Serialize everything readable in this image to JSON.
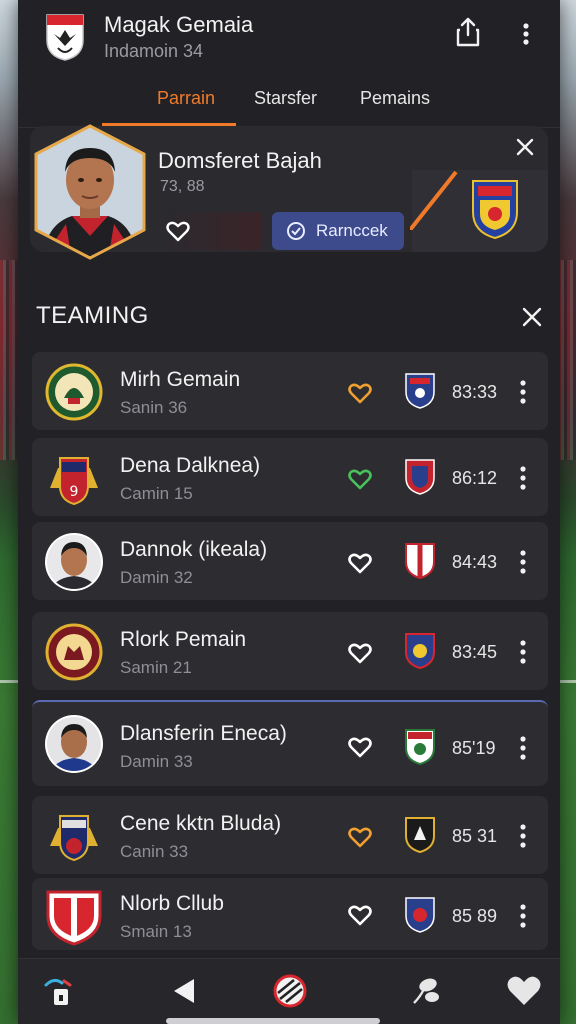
{
  "header": {
    "title": "Magak Gemaia",
    "subtitle": "Indamoin 34",
    "logo_icon": "club-crest-icon",
    "share_icon": "share-icon",
    "more_icon": "more-vertical-icon"
  },
  "tabs": [
    {
      "label": "Parrain",
      "active": true
    },
    {
      "label": "Starsfer",
      "active": false
    },
    {
      "label": "Pemains",
      "active": false
    }
  ],
  "featured": {
    "name": "Domsferet Bajah",
    "meta": "73, 88",
    "like_icon": "heart-icon",
    "action_label": "Rarnccek",
    "action_icon": "clock-icon",
    "close_icon": "close-icon",
    "crest_icon": "club-crest-icon"
  },
  "section": {
    "title": "TEAMING",
    "close_icon": "close-icon"
  },
  "rows": [
    {
      "name": "Mirh Gemain",
      "sub": "Sanin 36",
      "time": "83:33",
      "heart_color": "#f0a030",
      "avatar": "club-crest-icon"
    },
    {
      "name": "Dena Dalknea)",
      "sub": "Camin 15",
      "time": "86:12",
      "heart_color": "#49c25a",
      "avatar": "club-crest-icon"
    },
    {
      "name": "Dannok (ikeala)",
      "sub": "Damin 32",
      "time": "84:43",
      "heart_color": "#ffffff",
      "avatar": "player-portrait-icon"
    },
    {
      "name": "Rlork Pemain",
      "sub": "Samin 21",
      "time": "83:45",
      "heart_color": "#ffffff",
      "avatar": "club-crest-icon"
    },
    {
      "name": "Dlansferin Eneca)",
      "sub": "Damin 33",
      "time": "85'19",
      "heart_color": "#ffffff",
      "avatar": "player-portrait-icon"
    },
    {
      "name": "Cene kktn Bluda)",
      "sub": "Canin 33",
      "time": "85 31",
      "heart_color": "#f0a030",
      "avatar": "club-crest-icon"
    },
    {
      "name": "Nlorb Cllub",
      "sub": "Smain 13",
      "time": "85 89",
      "heart_color": "#ffffff",
      "avatar": "club-crest-icon"
    }
  ],
  "bottom_nav": [
    {
      "icon": "tag-icon"
    },
    {
      "icon": "back-icon"
    },
    {
      "icon": "ball-icon"
    },
    {
      "icon": "plant-icon"
    },
    {
      "icon": "heart-icon"
    }
  ],
  "colors": {
    "accent": "#f07a2a",
    "action": "#3d4a8c",
    "panel": "#222226",
    "row": "#2c2c31"
  }
}
